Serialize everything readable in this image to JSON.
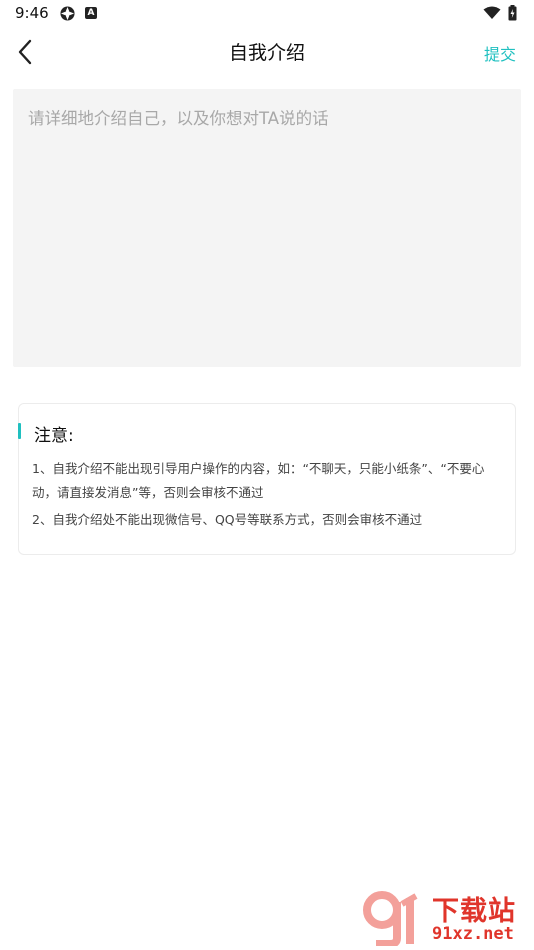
{
  "status_bar": {
    "time": "9:46"
  },
  "header": {
    "title": "自我介绍",
    "submit_label": "提交"
  },
  "intro": {
    "placeholder": "请详细地介绍自己，以及你想对TA说的话",
    "value": ""
  },
  "notice": {
    "title": "注意:",
    "items": [
      "1、自我介绍不能出现引导用户操作的内容，如：“不聊天，只能小纸条”、“不要心动，请直接发消息”等，否则会审核不通过",
      "2、自我介绍处不能出现微信号、QQ号等联系方式，否则会审核不通过"
    ]
  },
  "watermark": {
    "line1": "下载站",
    "line2": "91xz.net"
  },
  "colors": {
    "accent": "#20c0c0",
    "input_bg": "#f4f4f4",
    "watermark": "#e0352b"
  }
}
